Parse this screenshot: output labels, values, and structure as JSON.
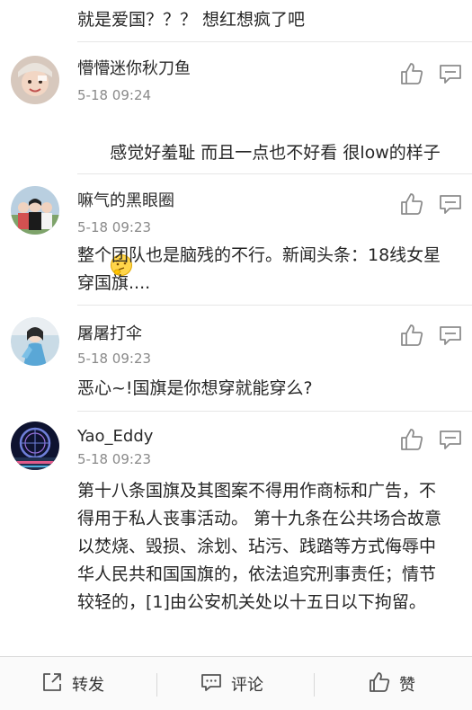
{
  "partial_comment": {
    "text": "就是爱国？？？ 想红想疯了吧"
  },
  "comments": [
    {
      "username": "懵懵迷你秋刀鱼",
      "time": "5-18 09:24",
      "text": "感觉好羞耻 而且一点也不好看 很low的样子",
      "emoji": "thinking-emoji"
    },
    {
      "username": "嘛气的黑眼圈",
      "time": "5-18 09:23",
      "text": "整个团队也是脑残的不行。新闻头条：18线女星穿国旗...."
    },
    {
      "username": "屠屠打伞",
      "time": "5-18 09:23",
      "text": "恶心~!国旗是你想穿就能穿么?"
    },
    {
      "username": "Yao_Eddy",
      "time": "5-18 09:23",
      "text": "第十八条国旗及其图案不得用作商标和广告，不得用于私人丧事活动。 第十九条在公共场合故意以焚烧、毁损、涂划、玷污、践踏等方式侮辱中华人民共和国国旗的，依法追究刑事责任；情节较轻的，[1]由公安机关处以十五日以下拘留。"
    }
  ],
  "action_bar": {
    "repost_label": "转发",
    "comment_label": "评论",
    "like_label": "赞"
  },
  "icons": {
    "like": "thumbs-up-icon",
    "reply": "comment-icon",
    "repost": "repost-icon"
  },
  "colors": {
    "text": "#262626",
    "meta": "#8a8a8a",
    "icon": "#8c8c8c",
    "bar_bg": "#fafafa"
  }
}
